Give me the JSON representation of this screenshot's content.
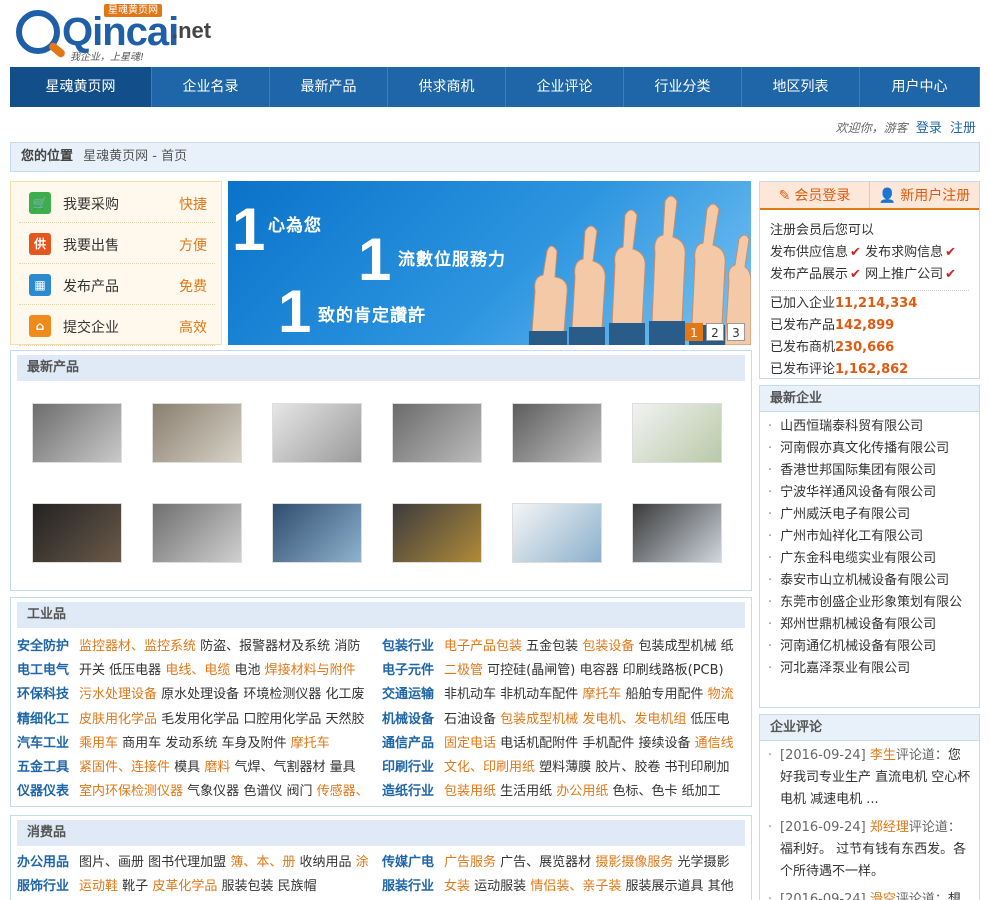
{
  "logo": {
    "word": "Qincai",
    "net": ".net",
    "badge": "星魂黄页网",
    "slogan": "我企业，上星魂!"
  },
  "nav": [
    "星魂黄页网",
    "企业名录",
    "最新产品",
    "供求商机",
    "企业评论",
    "行业分类",
    "地区列表",
    "用户中心"
  ],
  "welcome": {
    "text": "欢迎你，游客",
    "login": "登录",
    "register": "注册"
  },
  "breadcrumb": {
    "label": "您的位置",
    "path": "星魂黄页网 - 首页"
  },
  "quick": [
    {
      "icon": "cart-icon",
      "label": "我要采购",
      "tag": "快捷",
      "color": "#3cae4c",
      "glyph": "🛒"
    },
    {
      "icon": "supply-icon",
      "label": "我要出售",
      "tag": "方便",
      "color": "#e5561f",
      "glyph": "供"
    },
    {
      "icon": "product-icon",
      "label": "发布产品",
      "tag": "免费",
      "color": "#2b8ad0",
      "glyph": "▦"
    },
    {
      "icon": "home-icon",
      "label": "提交企业",
      "tag": "高效",
      "color": "#ef8a1c",
      "glyph": "⌂"
    }
  ],
  "banner": {
    "line1": "心為您",
    "line2": "流數位服務力",
    "line3": "致的肯定讚許",
    "pages": [
      "1",
      "2",
      "3"
    ]
  },
  "member": {
    "login_tab": "会员登录",
    "register_tab": "新用户注册",
    "intro": "注册会员后您可以",
    "perks": [
      [
        "发布供应信息",
        "发布求购信息"
      ],
      [
        "发布产品展示",
        "网上推广公司"
      ]
    ],
    "stats": [
      {
        "label": "已加入企业",
        "value": "11,214,334"
      },
      {
        "label": "已发布产品",
        "value": "142,899"
      },
      {
        "label": "已发布商机",
        "value": "230,666"
      },
      {
        "label": "已发布评论",
        "value": "1,162,862"
      }
    ]
  },
  "new_products": {
    "title": "最新产品"
  },
  "industry": {
    "title": "工业品",
    "rows_left": [
      {
        "head": "安全防护",
        "items": [
          [
            "监控器材、监控系统",
            1
          ],
          [
            "防盗、报警器材及系统",
            0
          ],
          [
            "消防",
            0
          ]
        ]
      },
      {
        "head": "电工电气",
        "items": [
          [
            "开关",
            0
          ],
          [
            "低压电器",
            0
          ],
          [
            "电线、电缆",
            1
          ],
          [
            "电池",
            0
          ],
          [
            "焊接材料与附件",
            1
          ]
        ]
      },
      {
        "head": "环保科技",
        "items": [
          [
            "污水处理设备",
            1
          ],
          [
            "原水处理设备",
            0
          ],
          [
            "环境检测仪器",
            0
          ],
          [
            "化工废",
            0
          ]
        ]
      },
      {
        "head": "精细化工",
        "items": [
          [
            "皮肤用化学品",
            1
          ],
          [
            "毛发用化学品",
            0
          ],
          [
            "口腔用化学品",
            0
          ],
          [
            "天然胶",
            0
          ]
        ]
      },
      {
        "head": "汽车工业",
        "items": [
          [
            "乘用车",
            1
          ],
          [
            "商用车",
            0
          ],
          [
            "发动系统",
            0
          ],
          [
            "车身及附件",
            0
          ],
          [
            "摩托车",
            1
          ]
        ]
      },
      {
        "head": "五金工具",
        "items": [
          [
            "紧固件、连接件",
            1
          ],
          [
            "模具",
            0
          ],
          [
            "磨料",
            1
          ],
          [
            "气焊、气割器材",
            0
          ],
          [
            "量具",
            0
          ]
        ]
      },
      {
        "head": "仪器仪表",
        "items": [
          [
            "室内环保检测仪器",
            1
          ],
          [
            "气象仪器",
            0
          ],
          [
            "色谱仪",
            0
          ],
          [
            "阀门",
            0
          ],
          [
            "传感器、",
            1
          ]
        ]
      }
    ],
    "rows_right": [
      {
        "head": "包装行业",
        "items": [
          [
            "电子产品包装",
            1
          ],
          [
            "五金包装",
            0
          ],
          [
            "包装设备",
            1
          ],
          [
            "包装成型机械",
            0
          ],
          [
            "纸",
            0
          ]
        ]
      },
      {
        "head": "电子元件",
        "items": [
          [
            "二极管",
            1
          ],
          [
            "可控硅(晶闸管)",
            0
          ],
          [
            "电容器",
            0
          ],
          [
            "印刷线路板(PCB)",
            0
          ]
        ]
      },
      {
        "head": "交通运输",
        "items": [
          [
            "非机动车",
            0
          ],
          [
            "非机动车配件",
            0
          ],
          [
            "摩托车",
            1
          ],
          [
            "船舶专用配件",
            0
          ],
          [
            "物流",
            1
          ]
        ]
      },
      {
        "head": "机械设备",
        "items": [
          [
            "石油设备",
            0
          ],
          [
            "包装成型机械",
            1
          ],
          [
            "发电机、发电机组",
            1
          ],
          [
            "低压电",
            0
          ]
        ]
      },
      {
        "head": "通信产品",
        "items": [
          [
            "固定电话",
            1
          ],
          [
            "电话机配附件",
            0
          ],
          [
            "手机配件",
            0
          ],
          [
            "接续设备",
            0
          ],
          [
            "通信线",
            1
          ]
        ]
      },
      {
        "head": "印刷行业",
        "items": [
          [
            "文化、印刷用纸",
            1
          ],
          [
            "塑料薄膜",
            0
          ],
          [
            "胶片、胶卷",
            0
          ],
          [
            "书刊印刷加",
            0
          ]
        ]
      },
      {
        "head": "造纸行业",
        "items": [
          [
            "包装用纸",
            1
          ],
          [
            "生活用纸",
            0
          ],
          [
            "办公用纸",
            1
          ],
          [
            "色标、色卡",
            0
          ],
          [
            "纸加工",
            0
          ]
        ]
      }
    ]
  },
  "consumer": {
    "title": "消费品",
    "rows_left": [
      {
        "head": "办公用品",
        "items": [
          [
            "图片、画册",
            0
          ],
          [
            "图书代理加盟",
            0
          ],
          [
            "簿、本、册",
            1
          ],
          [
            "收纳用品",
            0
          ],
          [
            "涂",
            1
          ]
        ]
      },
      {
        "head": "服饰行业",
        "items": [
          [
            "运动鞋",
            1
          ],
          [
            "靴子",
            0
          ],
          [
            "皮革化学品",
            1
          ],
          [
            "服装包装",
            0
          ],
          [
            "民族帽",
            0
          ]
        ]
      }
    ],
    "rows_right": [
      {
        "head": "传媒广电",
        "items": [
          [
            "广告服务",
            1
          ],
          [
            "广告、展览器材",
            0
          ],
          [
            "摄影摄像服务",
            1
          ],
          [
            "光学摄影",
            0
          ]
        ]
      },
      {
        "head": "服装行业",
        "items": [
          [
            "女装",
            1
          ],
          [
            "运动服装",
            0
          ],
          [
            "情侣装、亲子装",
            1
          ],
          [
            "服装展示道具",
            0
          ],
          [
            "其他",
            0
          ]
        ]
      }
    ]
  },
  "new_companies": {
    "title": "最新企业",
    "items": [
      "山西恒瑞泰科贸有限公司",
      "河南假亦真文化传播有限公司",
      "香港世邦国际集团有限公司",
      "宁波华祥通风设备有限公司",
      "广州威沃电子有限公司",
      "广州市灿祥化工有限公司",
      "广东金科电缆实业有限公司",
      "泰安市山立机械设备有限公司",
      "东莞市创盛企业形象策划有限公",
      "郑州世鼎机械设备有限公司",
      "河南通亿机械设备有限公司",
      "河北嘉泽泵业有限公司"
    ]
  },
  "comments": {
    "title": "企业评论",
    "say": "评论道：",
    "items": [
      {
        "date": "[2016-09-24]",
        "user": "李生",
        "text": "您好我司专业生产 直流电机 空心杯电机 减速电机 ..."
      },
      {
        "date": "[2016-09-24]",
        "user": "郑经理",
        "text": "福利好。 过节有钱有东西发。各个所待遇不一样。"
      },
      {
        "date": "[2016-09-24]",
        "user": "滑空",
        "text": "想找"
      }
    ]
  },
  "colors": {
    "nav": "#1f66a8",
    "accent": "#e07818",
    "link": "#1f66a8"
  }
}
